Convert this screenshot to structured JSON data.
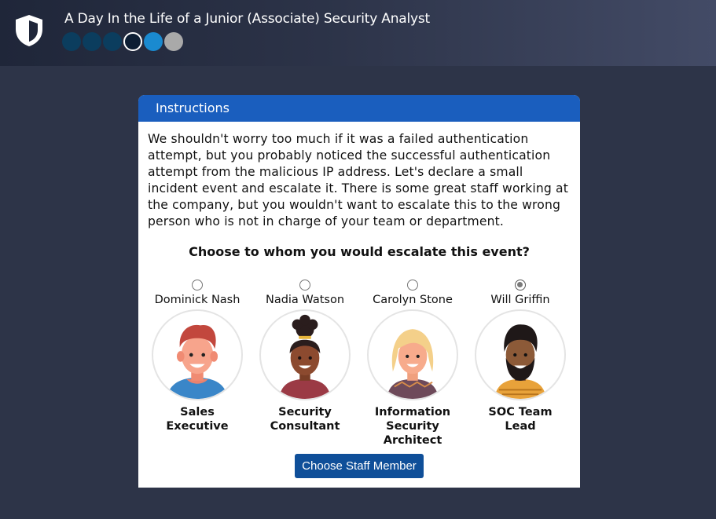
{
  "header": {
    "title": "A Day In the Life of a Junior (Associate) Security Analyst",
    "logo_icon": "shield-icon",
    "progress": [
      "done",
      "done",
      "done",
      "current",
      "next",
      "future"
    ]
  },
  "card": {
    "header": "Instructions",
    "instructions": "We shouldn't worry too much if it was a failed authentication attempt, but you probably noticed the successful authentication attempt from the malicious IP address. Let's declare a small incident event and escalate it. There is some great staff working at the company, but you wouldn't want to escalate this to the wrong person who is not in charge of your team or department.",
    "question": "Choose to whom you would escalate this event?",
    "staff": [
      {
        "name": "Dominick Nash",
        "role": "Sales Executive",
        "selected": false
      },
      {
        "name": "Nadia Watson",
        "role": "Security Consultant",
        "selected": false
      },
      {
        "name": "Carolyn Stone",
        "role": "Information Security Architect",
        "selected": false
      },
      {
        "name": "Will Griffin",
        "role": "SOC Team Lead",
        "selected": true
      }
    ],
    "button_label": "Choose Staff Member"
  }
}
